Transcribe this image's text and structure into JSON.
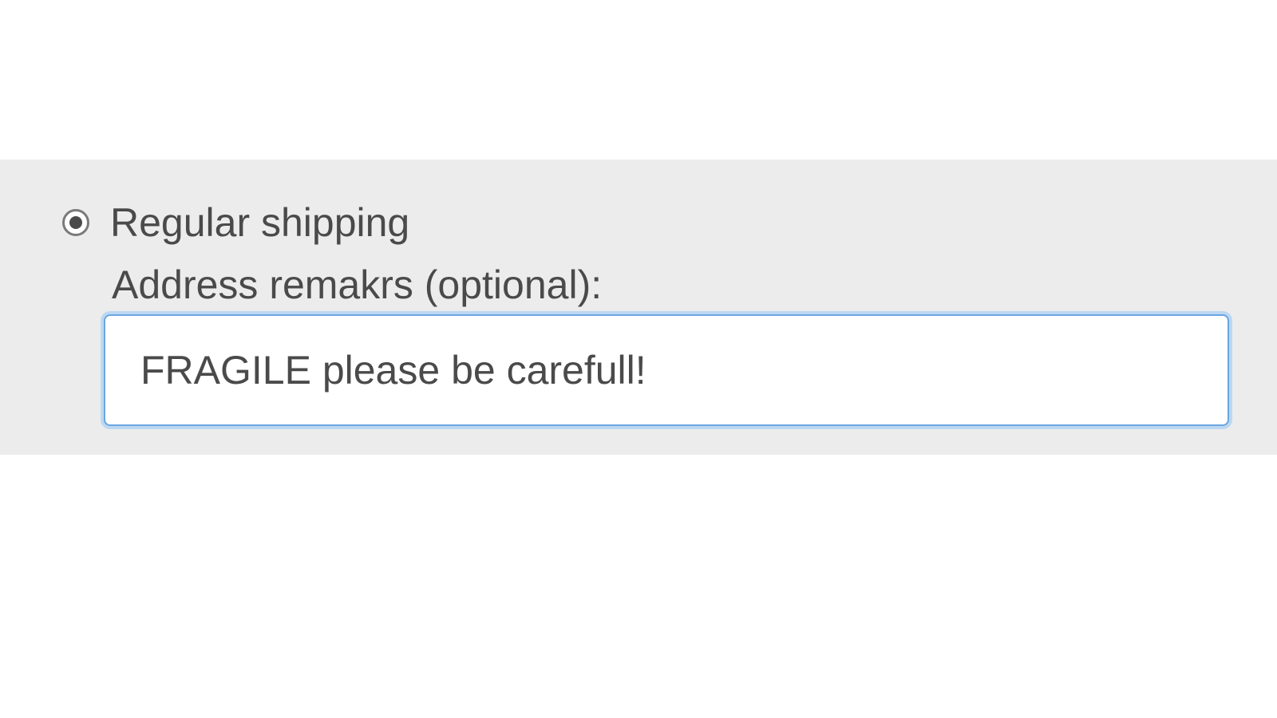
{
  "shipping": {
    "option_regular_label": "Regular shipping",
    "address_remarks_label": "Address remakrs (optional):",
    "address_remarks_value": "FRAGILE please be carefull!"
  }
}
